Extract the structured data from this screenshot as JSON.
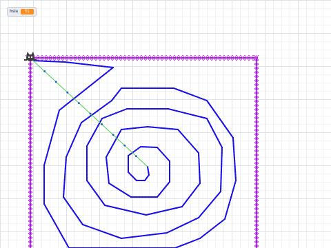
{
  "variable_monitor": {
    "label": "hsla",
    "value": "51"
  },
  "sprite": {
    "icon": "cat-sprite-icon"
  },
  "colors": {
    "border": "#9a1bd6",
    "border_cross": "#c040e8",
    "spiral": "#1a10e8",
    "path_line": "#4cd14c",
    "path_dot": "#1560c8",
    "monitor_value_bg": "#ff8c1a",
    "grid": "#dfe3e8"
  }
}
